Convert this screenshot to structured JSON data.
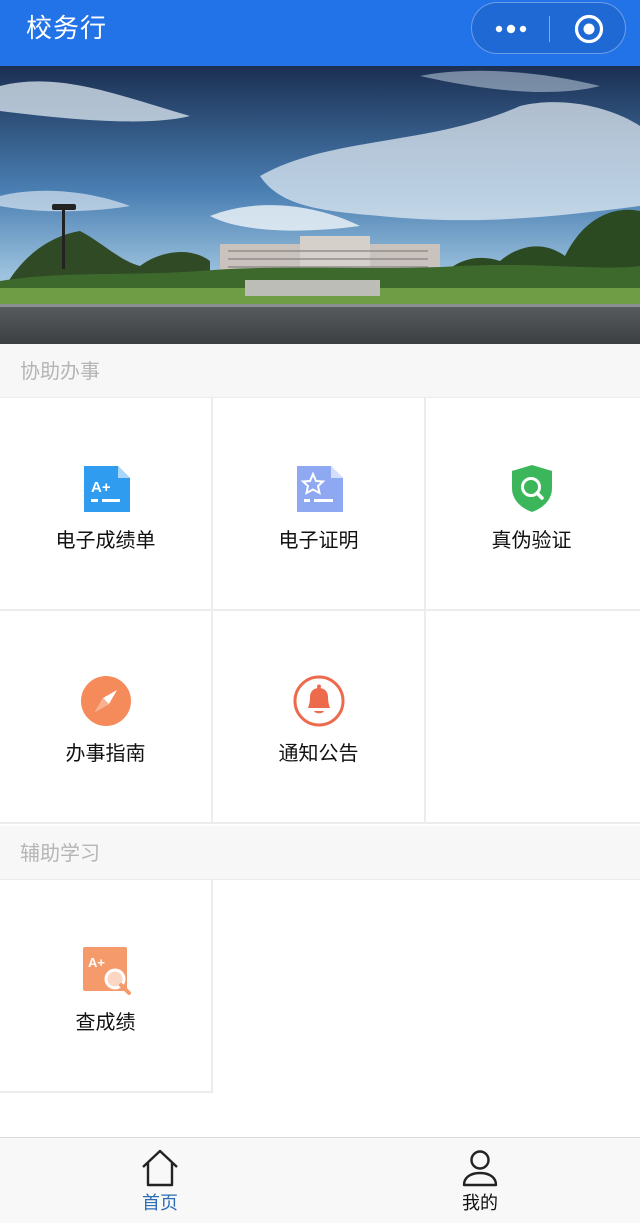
{
  "header": {
    "title": "校务行",
    "more_icon": "more-dots-icon",
    "close_icon": "circle-target-icon"
  },
  "colors": {
    "brand": "#2272e8",
    "tab_active": "#2c6db5",
    "tab_inactive": "#111111",
    "section_text": "#b5b5b5"
  },
  "sections": [
    {
      "title": "协助办事",
      "items": [
        {
          "label": "电子成绩单",
          "icon": "transcript-a-plus-icon"
        },
        {
          "label": "电子证明",
          "icon": "certificate-star-icon"
        },
        {
          "label": "真伪验证",
          "icon": "shield-search-icon"
        },
        {
          "label": "办事指南",
          "icon": "compass-icon"
        },
        {
          "label": "通知公告",
          "icon": "bell-icon"
        }
      ]
    },
    {
      "title": "辅助学习",
      "items": [
        {
          "label": "查成绩",
          "icon": "grade-search-icon"
        }
      ]
    }
  ],
  "tabbar": {
    "tabs": [
      {
        "label": "首页",
        "icon": "home-icon",
        "active": true
      },
      {
        "label": "我的",
        "icon": "user-icon",
        "active": false
      }
    ]
  }
}
